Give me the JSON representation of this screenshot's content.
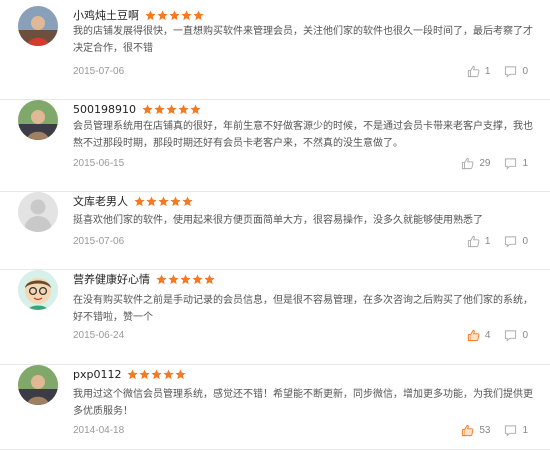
{
  "reviews": [
    {
      "user": "小鸡炖土豆啊",
      "rating": 5,
      "text": "我的店铺发展得很快，一直想购买软件来管理会员，关注他们家的软件也很久一段时间了，最后考察了才决定合作，很不错",
      "date": "2015-07-06",
      "likes": "1",
      "comments": "0",
      "liked": false,
      "avatar_icon": "photo-avatar-icon"
    },
    {
      "user": "500198910",
      "rating": 5,
      "text": "会员管理系统用在店铺真的很好，年前生意不好做客源少的时候，不是通过会员卡带来老客户支撑，我也熬不过那段时期，那段时期还好有会员卡老客户来，不然真的没生意做了。",
      "date": "2015-06-15",
      "likes": "29",
      "comments": "1",
      "liked": false,
      "avatar_icon": "photo-avatar-icon"
    },
    {
      "user": "文库老男人",
      "rating": 5,
      "text": "挺喜欢他们家的软件，使用起来很方便页面简单大方，很容易操作，没多久就能够使用熟悉了",
      "date": "2015-07-06",
      "likes": "1",
      "comments": "0",
      "liked": false,
      "avatar_icon": "default-avatar-icon"
    },
    {
      "user": "营养健康好心情",
      "rating": 5,
      "text": "在没有购买软件之前是手动记录的会员信息，但是很不容易管理，在多次咨询之后购买了他们家的系统，好不错啦，赞一个",
      "date": "2015-06-24",
      "likes": "4",
      "comments": "0",
      "liked": true,
      "avatar_icon": "cartoon-avatar-icon"
    },
    {
      "user": "pxp0112",
      "rating": 5,
      "text": "我用过这个微信会员管理系统，感觉还不错！希望能不断更新，同步微信，增加更多功能，为我们提供更多优质服务！",
      "date": "2014-04-18",
      "likes": "53",
      "comments": "1",
      "liked": true,
      "avatar_icon": "photo-avatar-icon"
    }
  ],
  "colors": {
    "star": "#f47920",
    "like_active": "#f47920",
    "icon_gray": "#aaaaaa"
  }
}
